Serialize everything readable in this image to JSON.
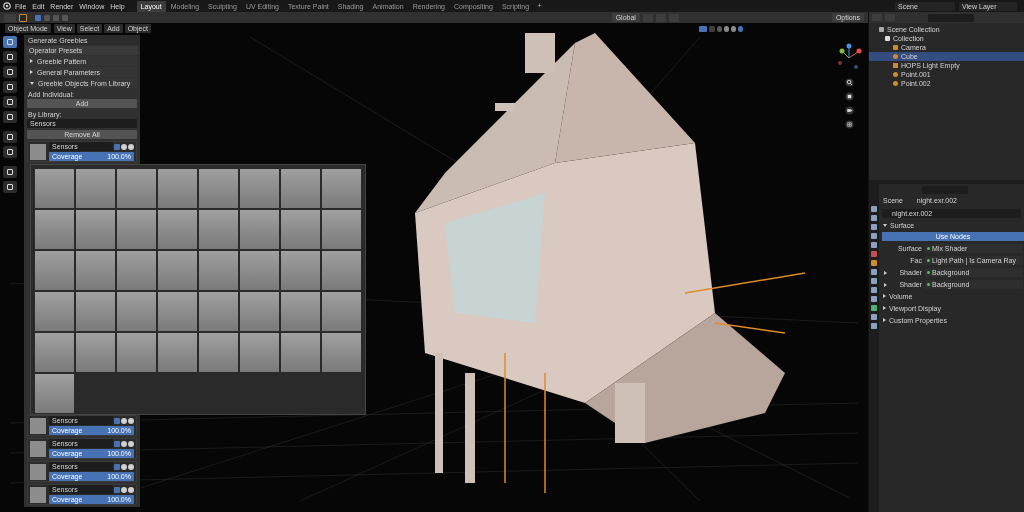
{
  "menu": [
    "File",
    "Edit",
    "Render",
    "Window",
    "Help"
  ],
  "workspaces": [
    {
      "label": "Layout",
      "selected": true
    },
    {
      "label": "Modeling",
      "selected": false
    },
    {
      "label": "Sculpting",
      "selected": false
    },
    {
      "label": "UV Editing",
      "selected": false
    },
    {
      "label": "Texture Paint",
      "selected": false
    },
    {
      "label": "Shading",
      "selected": false
    },
    {
      "label": "Animation",
      "selected": false
    },
    {
      "label": "Rendering",
      "selected": false
    },
    {
      "label": "Compositing",
      "selected": false
    },
    {
      "label": "Scripting",
      "selected": false
    }
  ],
  "add_workspace": "+",
  "scene": "Scene",
  "view_layer": "View Layer",
  "header": {
    "orientation": "Global",
    "options": "Options"
  },
  "viewport_header": {
    "mode": "Object Mode",
    "menus": [
      "View",
      "Select",
      "Add",
      "Object"
    ]
  },
  "operator_panel": {
    "title": "Generate Greebles",
    "presets": "Operator Presets",
    "sections": [
      {
        "label": "Greeble Pattern",
        "expanded": false
      },
      {
        "label": "General Parameters",
        "expanded": false
      },
      {
        "label": "Greeble Objects From Library",
        "expanded": true
      }
    ],
    "add_individual": "Add Individual:",
    "add_button": "Add",
    "by_library": "By Library:",
    "library": "Sensors",
    "remove_all": "Remove All",
    "items": [
      {
        "name": "Sensors",
        "label": "Coverage",
        "value": "100.0%",
        "level": 1
      },
      {
        "name": "Sensors",
        "label": "Coverage",
        "value": "100.0%",
        "level": 1
      },
      {
        "name": "Sensors",
        "label": "Coverage",
        "value": "100.0%",
        "level": 1
      },
      {
        "name": "Sensors",
        "label": "Coverage",
        "value": "100.0%",
        "level": 1
      },
      {
        "name": "Sensors",
        "label": "Coverage",
        "value": "100.0%",
        "level": 1
      }
    ]
  },
  "outliner": {
    "root": "Scene Collection",
    "collection": "Collection",
    "items": [
      {
        "label": "Camera",
        "kind": "camera",
        "selected": false
      },
      {
        "label": "Cube",
        "kind": "mesh",
        "selected": true
      },
      {
        "label": "HOPS Light Empty",
        "kind": "empty",
        "selected": false
      },
      {
        "label": "Point.001",
        "kind": "light",
        "selected": false
      },
      {
        "label": "Point.002",
        "kind": "light",
        "selected": false
      }
    ]
  },
  "properties": {
    "scene": "Scene",
    "world": "night.exr.002",
    "world_field": "night.exr.002",
    "surface_section": "Surface",
    "use_nodes": "Use Nodes",
    "rows": [
      {
        "label": "Surface",
        "value": "Mix Shader",
        "expandable": false
      },
      {
        "label": "Fac",
        "value": "Light Path | Is Camera Ray",
        "expandable": false
      },
      {
        "label": "Shader",
        "value": "Background",
        "expandable": true
      },
      {
        "label": "Shader",
        "value": "Background",
        "expandable": true
      }
    ],
    "sections": [
      "Volume",
      "Viewport Display",
      "Custom Properties"
    ]
  }
}
